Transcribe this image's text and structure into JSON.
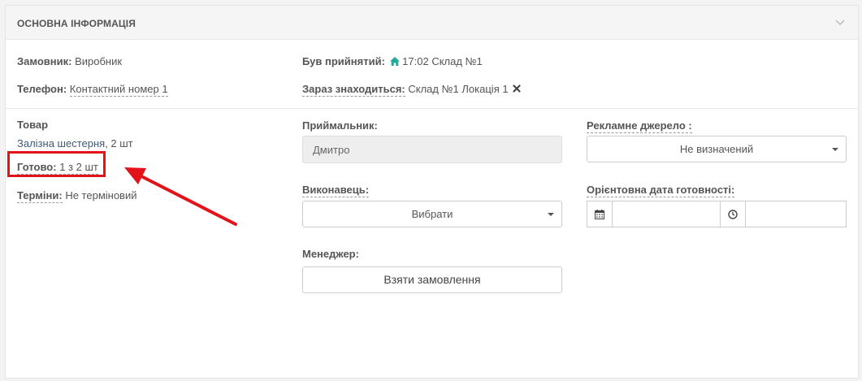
{
  "panel": {
    "title": "ОСНОВНА ІНФОРМАЦІЯ"
  },
  "customer": {
    "label": "Замовник:",
    "value": "Виробник"
  },
  "phone": {
    "label": "Телефон:",
    "value": "Контактний номер 1"
  },
  "accepted": {
    "label": "Був прийнятий:",
    "time": "17:02",
    "value": "Склад №1"
  },
  "location": {
    "label": "Зараз знаходиться:",
    "value": "Склад №1 Локація 1"
  },
  "product": {
    "heading": "Товар",
    "item": "Залізна шестерня",
    "qty": ", 2 шт"
  },
  "ready": {
    "label": "Готово:",
    "value": "1 з 2 шт"
  },
  "terms": {
    "label": "Терміни:",
    "value": "Не терміновий"
  },
  "receiver": {
    "label": "Приймальник:",
    "value": "Дмитро"
  },
  "executor": {
    "label": "Виконавець:",
    "selected": "Вибрати"
  },
  "manager": {
    "label": "Менеджер:",
    "button": "Взяти замовлення"
  },
  "ad_source": {
    "label": "Рекламне джерело :",
    "selected": "Не визначений"
  },
  "ready_date": {
    "label": "Орієнтовна дата готовності:",
    "date": "",
    "time": ""
  },
  "colors": {
    "accent_red": "#e3131b",
    "home_icon": "#26a89a",
    "link": "#3d5a7a"
  }
}
